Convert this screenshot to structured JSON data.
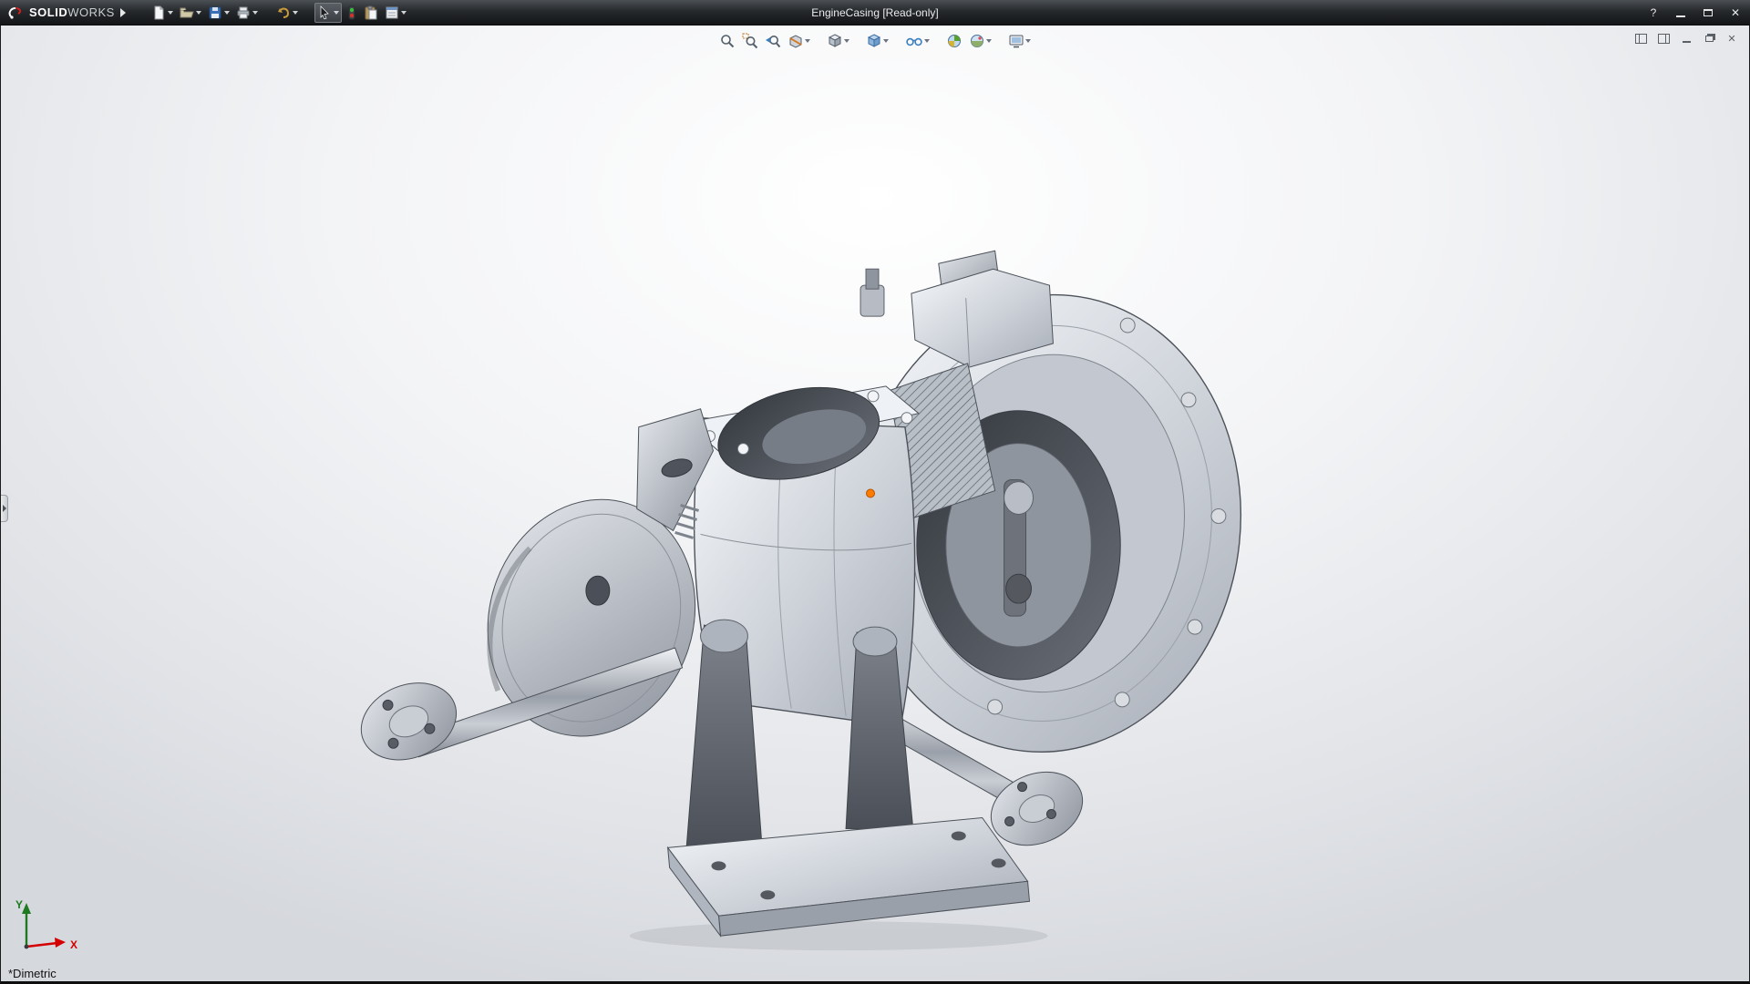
{
  "colors": {
    "titlebar_bg": "#26292c",
    "accent_blue": "#3a7ebf",
    "axis_x": "#d40000",
    "axis_y": "#1e7a1e",
    "selection_orange": "#ff7b00"
  },
  "titlebar": {
    "brand_bold": "SOLID",
    "brand_light": "WORKS",
    "title": "EngineCasing [Read-only]",
    "controls": {
      "help": "?",
      "close": "✕"
    }
  },
  "toolbar": {
    "items": [
      "new-document",
      "open",
      "save",
      "print",
      "undo",
      "select",
      "rebuild",
      "paste",
      "options"
    ]
  },
  "headsup": {
    "items": [
      "zoom-to-fit",
      "zoom-to-area",
      "previous-view",
      "section-view",
      "view-orientation",
      "display-style",
      "hide-show-items",
      "edit-appearance",
      "apply-scene",
      "view-settings"
    ]
  },
  "doc_controls": {
    "close": "✕"
  },
  "viewport": {
    "orientation_label": "*Dimetric",
    "triad": {
      "x_label": "X",
      "y_label": "Y"
    }
  }
}
